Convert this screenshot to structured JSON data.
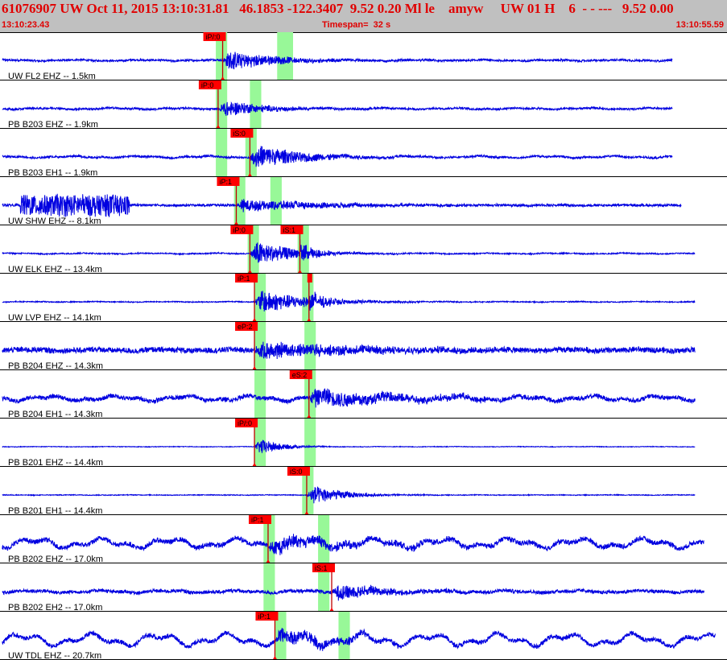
{
  "header": {
    "title": "61076907 UW Oct 11, 2015 13:10:31.81   46.1853 -122.3407  9.52 0.20 Ml le    amyw     UW 01 H    6  - - ---   9.52 0.00",
    "start_time": "13:10:23.43",
    "timespan": "Timespan=  32 s",
    "end_time": "13:10:55.59"
  },
  "colors": {
    "header_bg": "#c0c0c0",
    "header_text": "#e00000",
    "trace": "#0000e0",
    "pick_flag": "#ff0000",
    "window": "#98f898",
    "divider": "#000000"
  },
  "channels": [
    {
      "label": "UW FL2 EHZ -- 1.5km",
      "picks": [
        {
          "tag": "iP/:0",
          "t": 9.8
        }
      ],
      "windows": [
        [
          9.5,
          10.0
        ],
        [
          12.2,
          12.9
        ]
      ],
      "noise": 0.1,
      "lf": 0.04,
      "burst": 1.0,
      "burst_len": 5,
      "pre_burst": null,
      "amp_before": 1,
      "t_end": 29.6
    },
    {
      "label": "PB B203 EHZ -- 1.9km",
      "picks": [
        {
          "tag": "iP:0",
          "t": 9.6
        }
      ],
      "windows": [
        [
          9.5,
          10.0
        ],
        [
          11.0,
          11.5
        ]
      ],
      "noise": 0.1,
      "lf": 0.05,
      "burst": 0.9,
      "burst_len": 4,
      "pre_burst": null,
      "amp_before": 1,
      "t_end": 29.6
    },
    {
      "label": "PB B203 EH1 -- 1.9km",
      "picks": [
        {
          "tag": "iS:0",
          "t": 11.0
        }
      ],
      "windows": [
        [
          9.5,
          10.0
        ],
        [
          10.8,
          11.3
        ]
      ],
      "noise": 0.1,
      "lf": 0.07,
      "burst": 1.2,
      "burst_len": 5,
      "pre_burst": null,
      "amp_before": 1,
      "t_end": 29.6
    },
    {
      "label": "UW SHW EHZ -- 8.1km",
      "picks": [
        {
          "tag": "iP:1",
          "t": 10.4
        }
      ],
      "windows": [
        [
          10.3,
          10.8
        ],
        [
          11.9,
          12.4
        ]
      ],
      "noise": 0.12,
      "lf": 0.02,
      "burst": 0.6,
      "burst_len": 9,
      "pre_burst": [
        0.9,
        5.7
      ],
      "amp_before": 1,
      "t_end": 30.0
    },
    {
      "label": "UW ELK EHZ -- 13.4km",
      "picks": [
        {
          "tag": "iP:0",
          "t": 11.0
        },
        {
          "tag": "iS:1",
          "t": 13.2
        }
      ],
      "windows": [
        [
          10.9,
          11.4
        ],
        [
          13.1,
          13.6
        ]
      ],
      "noise": 0.06,
      "lf": 0.03,
      "burst": 1.3,
      "burst_len": 4,
      "pre_burst": null,
      "amp_before": 1,
      "t_end": 30.6
    },
    {
      "label": "UW LVP EHZ -- 14.1km",
      "picks": [
        {
          "tag": "iP:1",
          "t": 11.2
        },
        {
          "tag": "",
          "t": 13.6
        }
      ],
      "windows": [
        [
          11.2,
          11.7
        ],
        [
          13.3,
          13.8
        ]
      ],
      "noise": 0.05,
      "lf": 0.02,
      "burst": 1.2,
      "burst_len": 5,
      "pre_burst": null,
      "amp_before": 1,
      "t_end": 30.6
    },
    {
      "label": "PB B204 EHZ -- 14.3km",
      "picks": [
        {
          "tag": "eP:2",
          "t": 11.2
        }
      ],
      "windows": [
        [
          11.2,
          11.7
        ],
        [
          13.4,
          13.9
        ]
      ],
      "noise": 0.28,
      "lf": 0.06,
      "burst": 0.8,
      "burst_len": 9,
      "pre_burst": null,
      "amp_before": 1,
      "t_end": 30.6
    },
    {
      "label": "PB B204 EH1 -- 14.3km",
      "picks": [
        {
          "tag": "eS:2",
          "t": 13.6
        }
      ],
      "windows": [
        [
          11.2,
          11.7
        ],
        [
          13.4,
          13.9
        ]
      ],
      "noise": 0.22,
      "lf": 0.18,
      "burst": 0.9,
      "burst_len": 9,
      "pre_burst": null,
      "amp_before": 1,
      "t_end": 30.6
    },
    {
      "label": "PB B201 EHZ -- 14.4km",
      "picks": [
        {
          "tag": "iP/:0",
          "t": 11.2
        }
      ],
      "windows": [
        [
          11.2,
          11.7
        ],
        [
          13.4,
          13.9
        ]
      ],
      "noise": 0.03,
      "lf": 0.01,
      "burst": 1.0,
      "burst_len": 2,
      "pre_burst": null,
      "amp_before": 1,
      "t_end": 30.6
    },
    {
      "label": "PB B201 EH1 -- 14.4km",
      "picks": [
        {
          "tag": "iS:0",
          "t": 13.5
        }
      ],
      "windows": [
        [
          13.3,
          13.8
        ]
      ],
      "noise": 0.04,
      "lf": 0.01,
      "burst": 1.1,
      "burst_len": 3,
      "pre_burst": null,
      "amp_before": 1,
      "t_end": 30.6
    },
    {
      "label": "PB B202 EHZ -- 17.0km",
      "picks": [
        {
          "tag": "iP:1",
          "t": 11.8
        }
      ],
      "windows": [
        [
          11.6,
          12.1
        ],
        [
          14.0,
          14.5
        ]
      ],
      "noise": 0.25,
      "lf": 0.35,
      "burst": 0.7,
      "burst_len": 8,
      "pre_burst": null,
      "amp_before": 1,
      "t_end": 31.0
    },
    {
      "label": "PB B202 EH2 -- 17.0km",
      "picks": [
        {
          "tag": "iS:1",
          "t": 14.6
        }
      ],
      "windows": [
        [
          11.6,
          12.1
        ],
        [
          14.0,
          14.5
        ]
      ],
      "noise": 0.18,
      "lf": 0.08,
      "burst": 0.8,
      "burst_len": 5,
      "pre_burst": null,
      "amp_before": 1,
      "t_end": 31.0
    },
    {
      "label": "UW TDL EHZ -- 20.7km",
      "picks": [
        {
          "tag": "iP:1",
          "t": 12.1
        }
      ],
      "windows": [
        [
          12.1,
          12.6
        ],
        [
          14.9,
          15.4
        ]
      ],
      "noise": 0.22,
      "lf": 0.45,
      "burst": 0.8,
      "burst_len": 6,
      "pre_burst": null,
      "amp_before": 1,
      "t_end": 31.5
    }
  ]
}
